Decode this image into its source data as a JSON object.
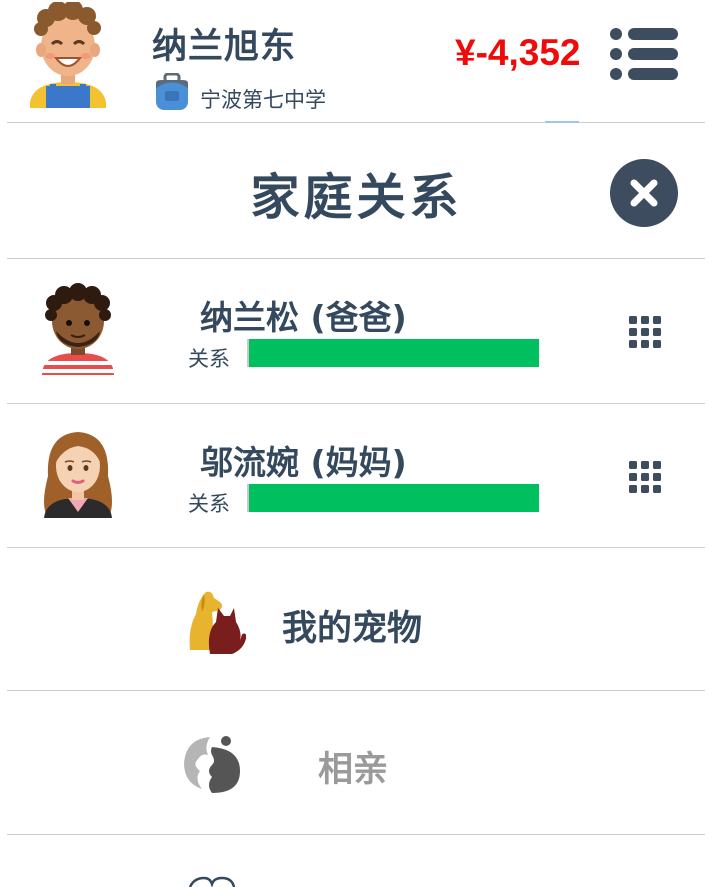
{
  "player": {
    "name": "纳兰旭东",
    "school": "宁波第七中学",
    "money": "¥-4,352"
  },
  "section": {
    "title": "家庭关系"
  },
  "family": [
    {
      "name": "纳兰松 (爸爸)",
      "relation_label": "关系",
      "relation_level": 1.0,
      "avatar": "father-avatar"
    },
    {
      "name": "邬流婉 (妈妈)",
      "relation_label": "关系",
      "relation_level": 1.0,
      "avatar": "mother-avatar"
    }
  ],
  "menu": [
    {
      "label": "我的宠物",
      "icon": "pet-icon",
      "enabled": true
    },
    {
      "label": "相亲",
      "icon": "dating-icon",
      "enabled": false
    }
  ],
  "colors": {
    "money": "#f00a0a",
    "text": "#34495e",
    "relation_bar": "#00bf5f",
    "disabled_text": "#9a9a9a",
    "close_button": "#3d4c5e"
  }
}
